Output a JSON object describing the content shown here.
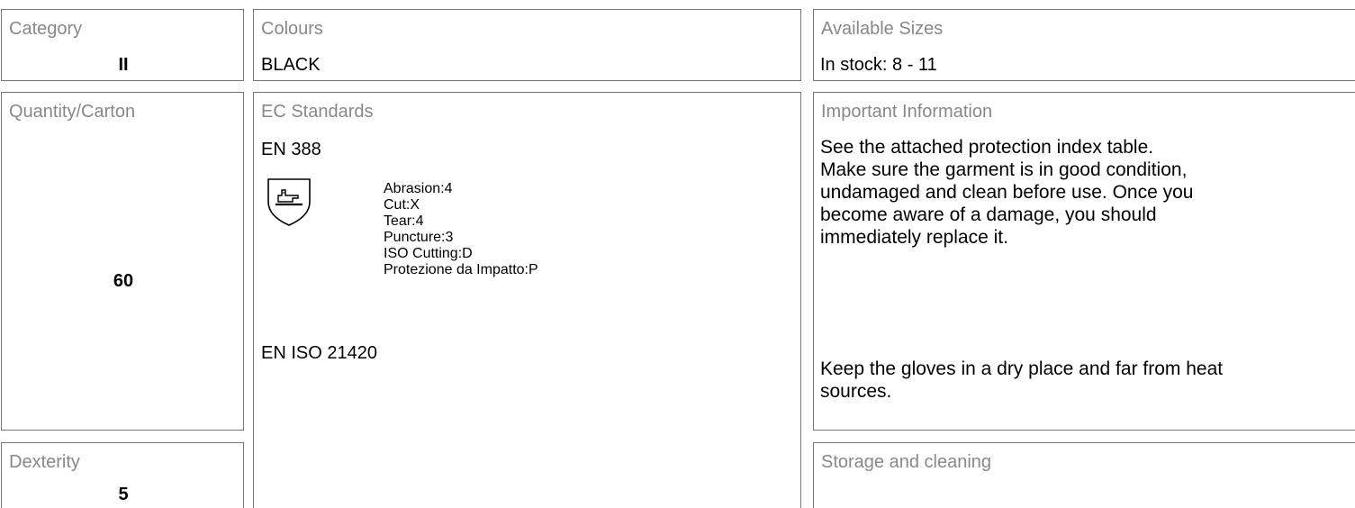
{
  "category": {
    "label": "Category",
    "value": "II"
  },
  "colours": {
    "label": "Colours",
    "value": "BLACK"
  },
  "sizes": {
    "label": "Available Sizes",
    "value": "In stock: 8 - 11"
  },
  "quantity": {
    "label": "Quantity/Carton",
    "value": "60"
  },
  "standards": {
    "label": "EC Standards",
    "en388": {
      "title": "EN 388",
      "icon": "glove-shield-icon",
      "ratings": [
        "Abrasion:4",
        "Cut:X",
        "Tear:4",
        "Puncture:3",
        "ISO Cutting:D",
        "Protezione da Impatto:P"
      ]
    },
    "iso21420": {
      "title": "EN ISO 21420"
    }
  },
  "important": {
    "label": "Important Information",
    "lines": [
      "See the attached protection index table.",
      "Make sure the garment is in good condition,",
      "undamaged and clean before use. Once you",
      "become aware of a damage, you should",
      "immediately replace it."
    ],
    "storage_lines": [
      "Keep the gloves in a dry place and far from heat",
      "sources."
    ]
  },
  "dexterity": {
    "label": "Dexterity",
    "value": "5"
  },
  "storage": {
    "label": "Storage and cleaning"
  }
}
